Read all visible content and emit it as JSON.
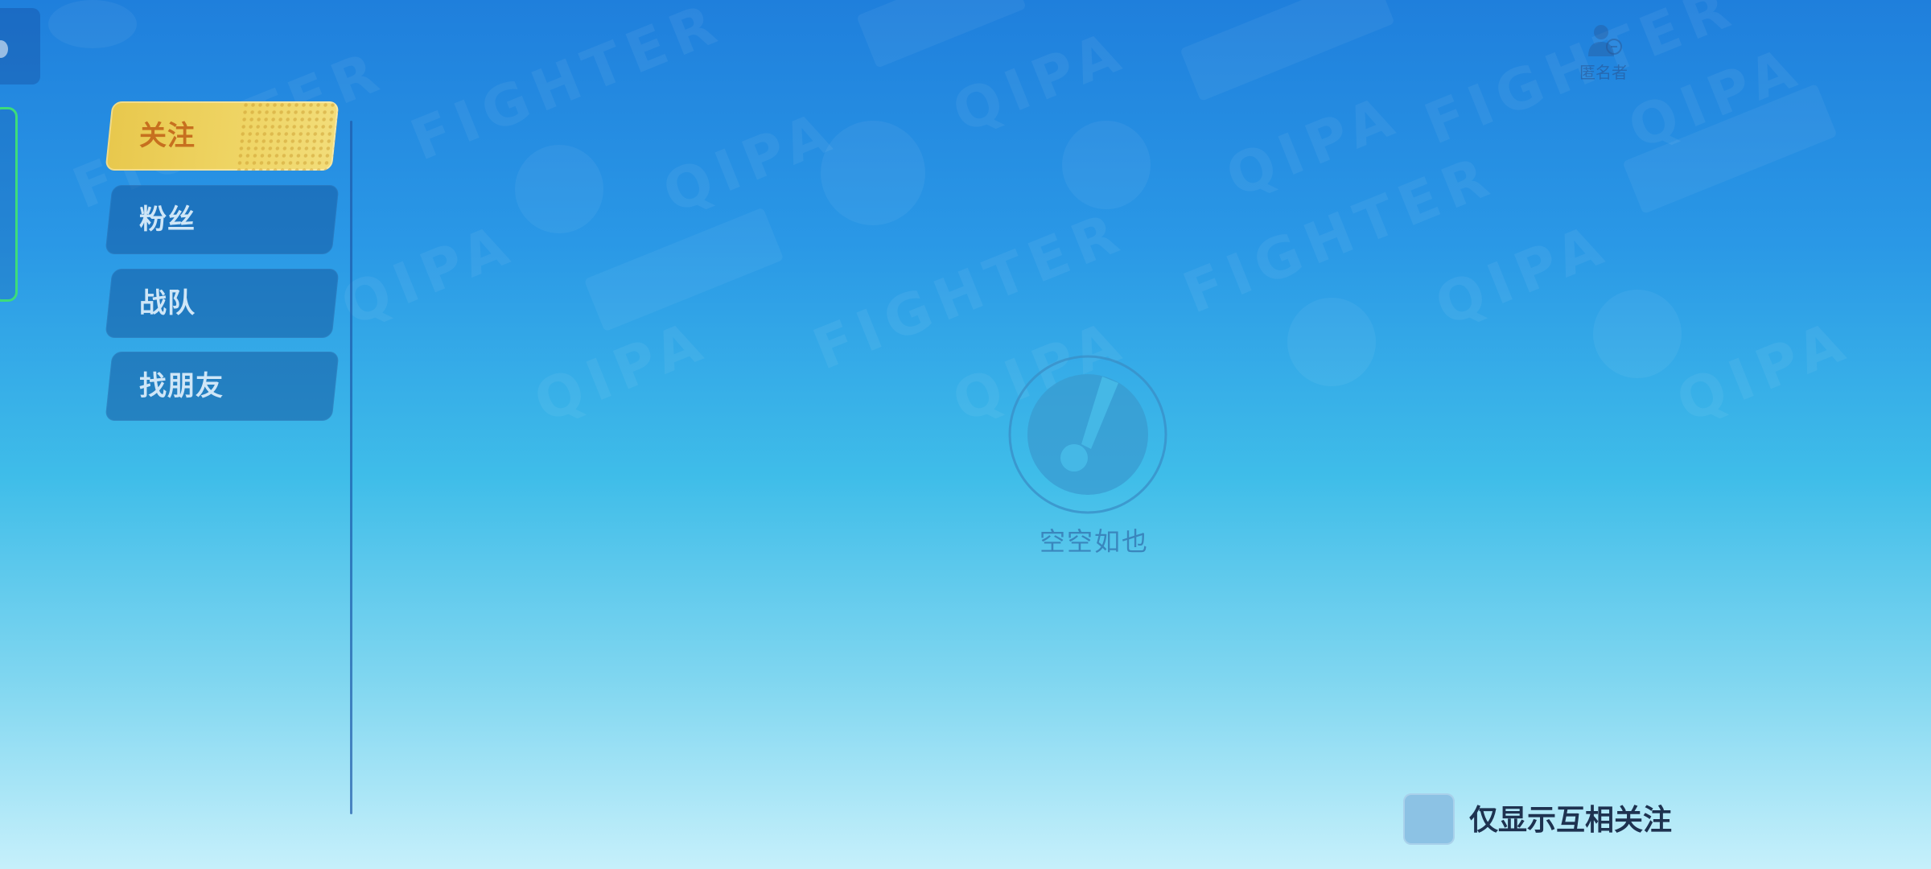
{
  "background": {
    "watermark_texts": [
      "FIGHTER",
      "QIPA"
    ]
  },
  "sidebar": {
    "tabs": [
      {
        "label": "关注",
        "active": true
      },
      {
        "label": "粉丝",
        "active": false
      },
      {
        "label": "战队",
        "active": false
      },
      {
        "label": "找朋友",
        "active": false
      }
    ]
  },
  "top_right": {
    "label": "匿名者",
    "icon": "user-icon"
  },
  "empty_state": {
    "icon": "exclamation-icon",
    "text": "空空如也"
  },
  "filter": {
    "checkbox_checked": false,
    "label": "仅显示互相关注"
  },
  "colors": {
    "active_tab": "#e8c84d",
    "active_tab_text": "#c7701f",
    "inactive_tab": "#1e5aa0",
    "empty_text": "#3a86bd",
    "checkbox": "#8cc2e4"
  }
}
